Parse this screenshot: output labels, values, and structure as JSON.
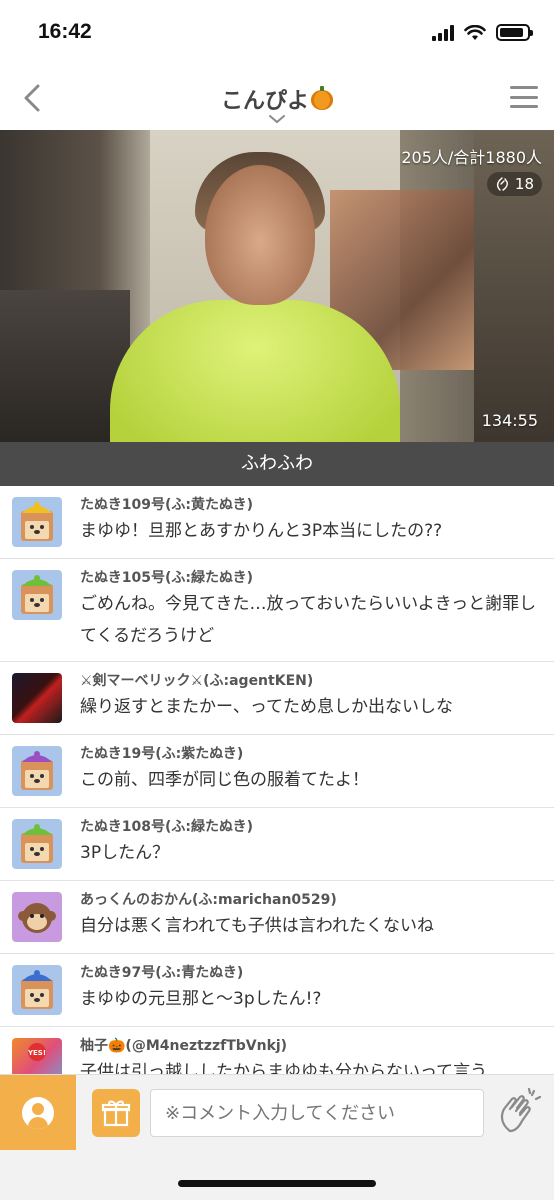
{
  "status_bar": {
    "time": "16:42",
    "battery_level": 0.9
  },
  "header": {
    "title": "こんぴよ",
    "title_icon": "pumpkin-icon",
    "back_icon": "chevron-left-icon",
    "menu_icon": "hamburger-menu-icon",
    "expand_icon": "chevron-down-icon"
  },
  "video": {
    "viewers": "205人/合計1880人",
    "claps": "18",
    "duration": "134:55"
  },
  "caption": "ふわふわ",
  "comments": [
    {
      "name": "たぬき109号(ふ:黄たぬき)",
      "text": "まゆゆ！旦那とあすかりんと3P本当にしたの??",
      "avatar": "tanuki",
      "hat": "#f0c020"
    },
    {
      "name": "たぬき105号(ふ:緑たぬき)",
      "text": "ごめんね。今見てきた…放っておいたらいいよきっと謝罪してくるだろうけど",
      "avatar": "tanuki",
      "hat": "#6fbf3a"
    },
    {
      "name": "⚔剣マーベリック⚔(ふ:agentKEN)",
      "text": "繰り返すとまたかー、ってため息しか出ないしな",
      "avatar": "photo",
      "hat": "#c02020"
    },
    {
      "name": "たぬき19号(ふ:紫たぬき)",
      "text": "この前、四季が同じ色の服着てたよ！",
      "avatar": "tanuki",
      "hat": "#9a4fc4"
    },
    {
      "name": "たぬき108号(ふ:緑たぬき)",
      "text": "3Pしたん？",
      "avatar": "tanuki",
      "hat": "#6fbf3a"
    },
    {
      "name": "あっくんのおかん(ふ:marichan0529)",
      "text": "自分は悪く言われても子供は言われたくないね",
      "avatar": "monkey",
      "hat": "#a050d0"
    },
    {
      "name": "たぬき97号(ふ:青たぬき)",
      "text": "まゆゆの元旦那と〜3pしたん!?",
      "avatar": "tanuki",
      "hat": "#3a6fd0"
    },
    {
      "name": "柚子🎃(@M4neztzzfTbVnkj)",
      "text": "子供は引っ越ししたからまゆゆも分からないって言う",
      "avatar": "yes",
      "hat": "#e05030"
    }
  ],
  "bottom_bar": {
    "input_placeholder": "※コメント入力してください",
    "profile_icon": "profile-icon",
    "gift_icon": "gift-icon",
    "clap_icon": "clap-hands-icon"
  },
  "colors": {
    "accent": "#f3b04a",
    "caption_bg": "#4b4b4b",
    "divider": "#e3e3e3"
  }
}
